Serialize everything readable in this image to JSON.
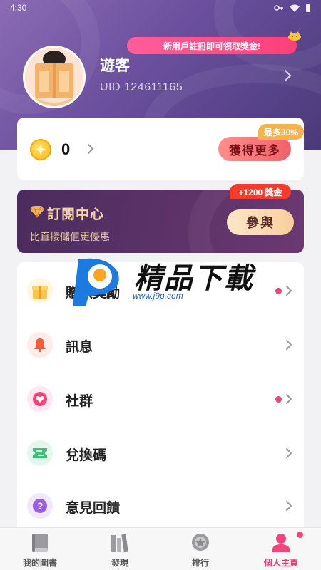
{
  "status_bar": {
    "time": "4:30"
  },
  "profile": {
    "promo": "新用戶註冊即可領取獎金!",
    "name": "遊客",
    "uid": "UID 124611165"
  },
  "wallet": {
    "coins": "0",
    "get_more_label": "獲得更多",
    "max_badge": "最多30%"
  },
  "subscription": {
    "title": "訂閱中心",
    "description": "比直接儲值更優惠",
    "join_label": "參與",
    "bonus_badge": "+1200 獎金"
  },
  "menu": [
    {
      "label": "贈取獎勵",
      "icon": "gift-icon",
      "dot": true
    },
    {
      "label": "訊息",
      "icon": "bell-icon",
      "dot": false
    },
    {
      "label": "社群",
      "icon": "heart-chat-icon",
      "dot": true
    },
    {
      "label": "兌換碼",
      "icon": "ticket-icon",
      "dot": false
    },
    {
      "label": "意見回饋",
      "icon": "question-icon",
      "dot": false
    }
  ],
  "watermark": {
    "text": "精品下載",
    "url": "www.j9p.com"
  },
  "bottom_nav": [
    {
      "label": "我的圖書",
      "icon": "book-icon",
      "active": false
    },
    {
      "label": "發現",
      "icon": "bookshelf-icon",
      "active": false
    },
    {
      "label": "排行",
      "icon": "medal-icon",
      "active": false
    },
    {
      "label": "個人主頁",
      "icon": "user-icon",
      "active": true
    }
  ],
  "colors": {
    "accent": "#e23b6d",
    "hero": "#6a4f9e",
    "coin": "#f6b716"
  }
}
